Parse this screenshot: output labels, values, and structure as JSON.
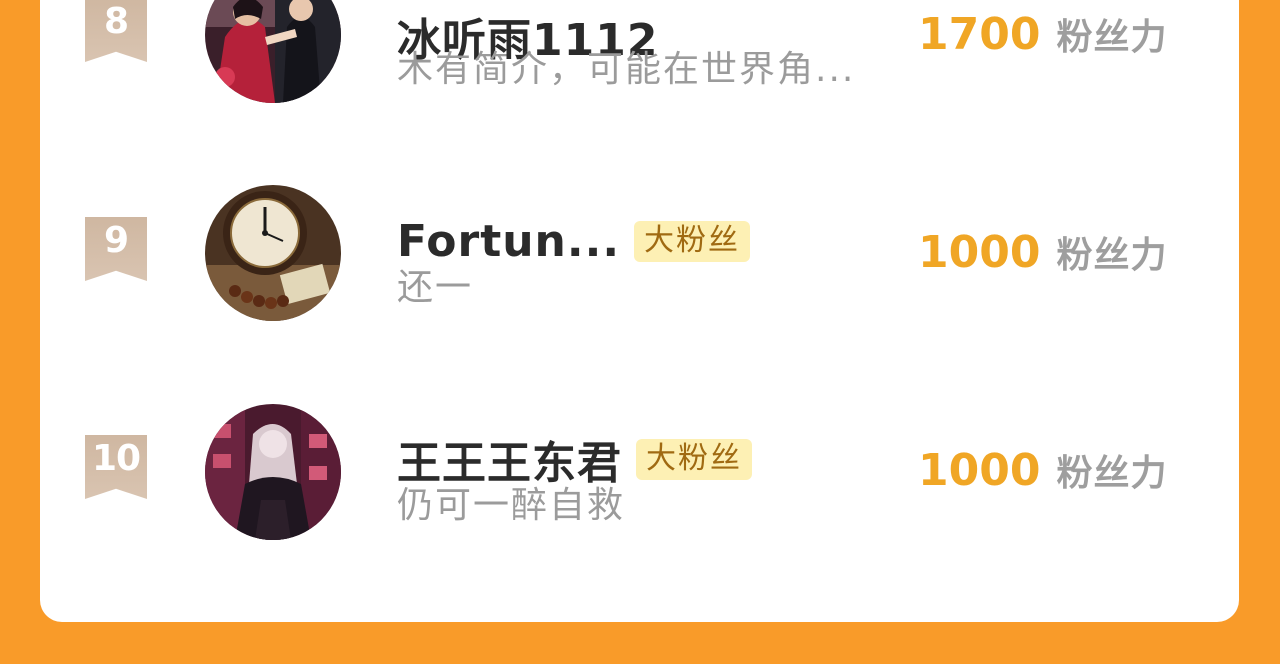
{
  "rankings": [
    {
      "rank": "8",
      "name": "冰听雨1112",
      "tag": "",
      "bio": "木有简介，可能在世界角...",
      "score": "1700",
      "score_unit": "粉丝力",
      "avatar": "photo-avatar"
    },
    {
      "rank": "9",
      "name": "Fortun...",
      "tag": "大粉丝",
      "bio": "还一",
      "score": "1000",
      "score_unit": "粉丝力",
      "avatar": "clock-avatar"
    },
    {
      "rank": "10",
      "name": "王王王东君",
      "tag": "大粉丝",
      "bio": "仍可一醉自救",
      "score": "1000",
      "score_unit": "粉丝力",
      "avatar": "anime-avatar"
    }
  ],
  "colors": {
    "background": "#f99b29",
    "card": "#ffffff",
    "score": "#f0a625",
    "tag_bg": "#fdf0b4",
    "rank_badge": "#d4bca6"
  }
}
